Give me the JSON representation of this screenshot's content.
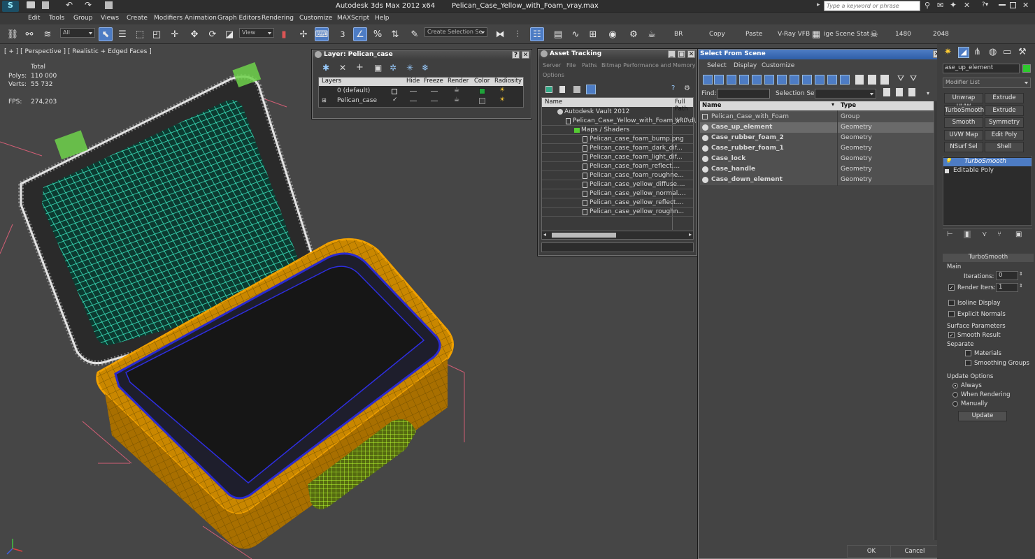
{
  "app": {
    "title": "Autodesk 3ds Max  2012 x64",
    "file": "Pelican_Case_Yellow_with_Foam_vray.max",
    "search_placeholder": "Type a keyword or phrase"
  },
  "menu": [
    "Edit",
    "Tools",
    "Group",
    "Views",
    "Create",
    "Modifiers",
    "Animation",
    "Graph Editors",
    "Rendering",
    "Customize",
    "MAXScript",
    "Help"
  ],
  "toolbar": {
    "filter": "All",
    "coord": "View",
    "snap_num": "3",
    "selection_set": "Create Selection Se",
    "items": [
      "BR",
      "Copy",
      "Paste",
      "V-Ray VFB",
      "ige Scene Stat",
      "1480",
      "2048"
    ]
  },
  "viewport": {
    "label": "[ + ] [ Perspective ] [ Realistic + Edged Faces ]",
    "stats": {
      "total": "Total",
      "polys_label": "Polys:",
      "polys": "110 000",
      "verts_label": "Verts:",
      "verts": "55 732",
      "fps_label": "FPS:",
      "fps": "274,203"
    }
  },
  "layer_panel": {
    "title": "Layer: Pelican_case",
    "columns": [
      "Layers",
      "Hide",
      "Freeze",
      "Render",
      "Color",
      "Radiosity"
    ],
    "rows": [
      {
        "name": "0 (default)",
        "color": "#1fa33a"
      },
      {
        "name": "Pelican_case",
        "color": "#3a3a3a"
      }
    ]
  },
  "asset_panel": {
    "title": "Asset Tracking",
    "menu": [
      "Server",
      "File",
      "Paths",
      "Bitmap Performance and Memory",
      "Options"
    ],
    "columns": [
      "Name",
      "Full Path"
    ],
    "vault": "Autodesk Vault 2012",
    "file": "Pelican_Case_Yellow_with_Foam_v...",
    "file_path": "\\\\R0\\d\\",
    "maps": "Maps / Shaders",
    "items": [
      "Pelican_case_foam_bump.png",
      "Pelican_case_foam_dark_dif...",
      "Pelican_case_foam_light_dif...",
      "Pelican_case_foam_reflect....",
      "Pelican_case_foam_roughne...",
      "Pelican_case_yellow_diffuse....",
      "Pelican_case_yellow_normal....",
      "Pelican_case_yellow_reflect....",
      "Pelican_case_yellow_roughn..."
    ]
  },
  "select_panel": {
    "title": "Select From Scene",
    "tabs": [
      "Select",
      "Display",
      "Customize"
    ],
    "find_label": "Find:",
    "selection_set_label": "Selection Set:",
    "columns": [
      "Name",
      "Type"
    ],
    "rows": [
      {
        "name": "Pelican_Case_with_Foam",
        "type": "Group",
        "bold": false
      },
      {
        "name": "Case_up_element",
        "type": "Geometry",
        "bold": true
      },
      {
        "name": "Case_rubber_foam_2",
        "type": "Geometry",
        "bold": true
      },
      {
        "name": "Case_rubber_foam_1",
        "type": "Geometry",
        "bold": true
      },
      {
        "name": "Case_lock",
        "type": "Geometry",
        "bold": true
      },
      {
        "name": "Case_handle",
        "type": "Geometry",
        "bold": true
      },
      {
        "name": "Case_down_element",
        "type": "Geometry",
        "bold": true
      }
    ],
    "ok": "OK",
    "cancel": "Cancel"
  },
  "command_panel": {
    "object_name": "ase_up_element",
    "modifier_list": "Modifier List",
    "buttons": [
      "Unwrap UVW",
      "Extrude",
      "TurboSmooth",
      "Extrude",
      "Smooth",
      "Symmetry",
      "UVW Map",
      "Edit Poly",
      "NSurf Sel",
      "Shell"
    ],
    "stack": [
      "TurboSmooth",
      "Editable Poly"
    ],
    "rollout": "TurboSmooth",
    "main": "Main",
    "iterations_label": "Iterations:",
    "iterations": "0",
    "render_iters_label": "Render Iters:",
    "render_iters": "1",
    "isoline": "Isoline Display",
    "explicit": "Explicit Normals",
    "surface_params": "Surface Parameters",
    "smooth_result": "Smooth Result",
    "separate": "Separate",
    "materials": "Materials",
    "smoothing_groups": "Smoothing Groups",
    "update_options": "Update Options",
    "always": "Always",
    "when_rendering": "When Rendering",
    "manually": "Manually",
    "update": "Update"
  },
  "colors": {
    "accent": "#4d7cc4",
    "case_yellow": "#f0a000",
    "foam_cyan": "#3ff0c8",
    "handle_green": "#b8ff30"
  }
}
